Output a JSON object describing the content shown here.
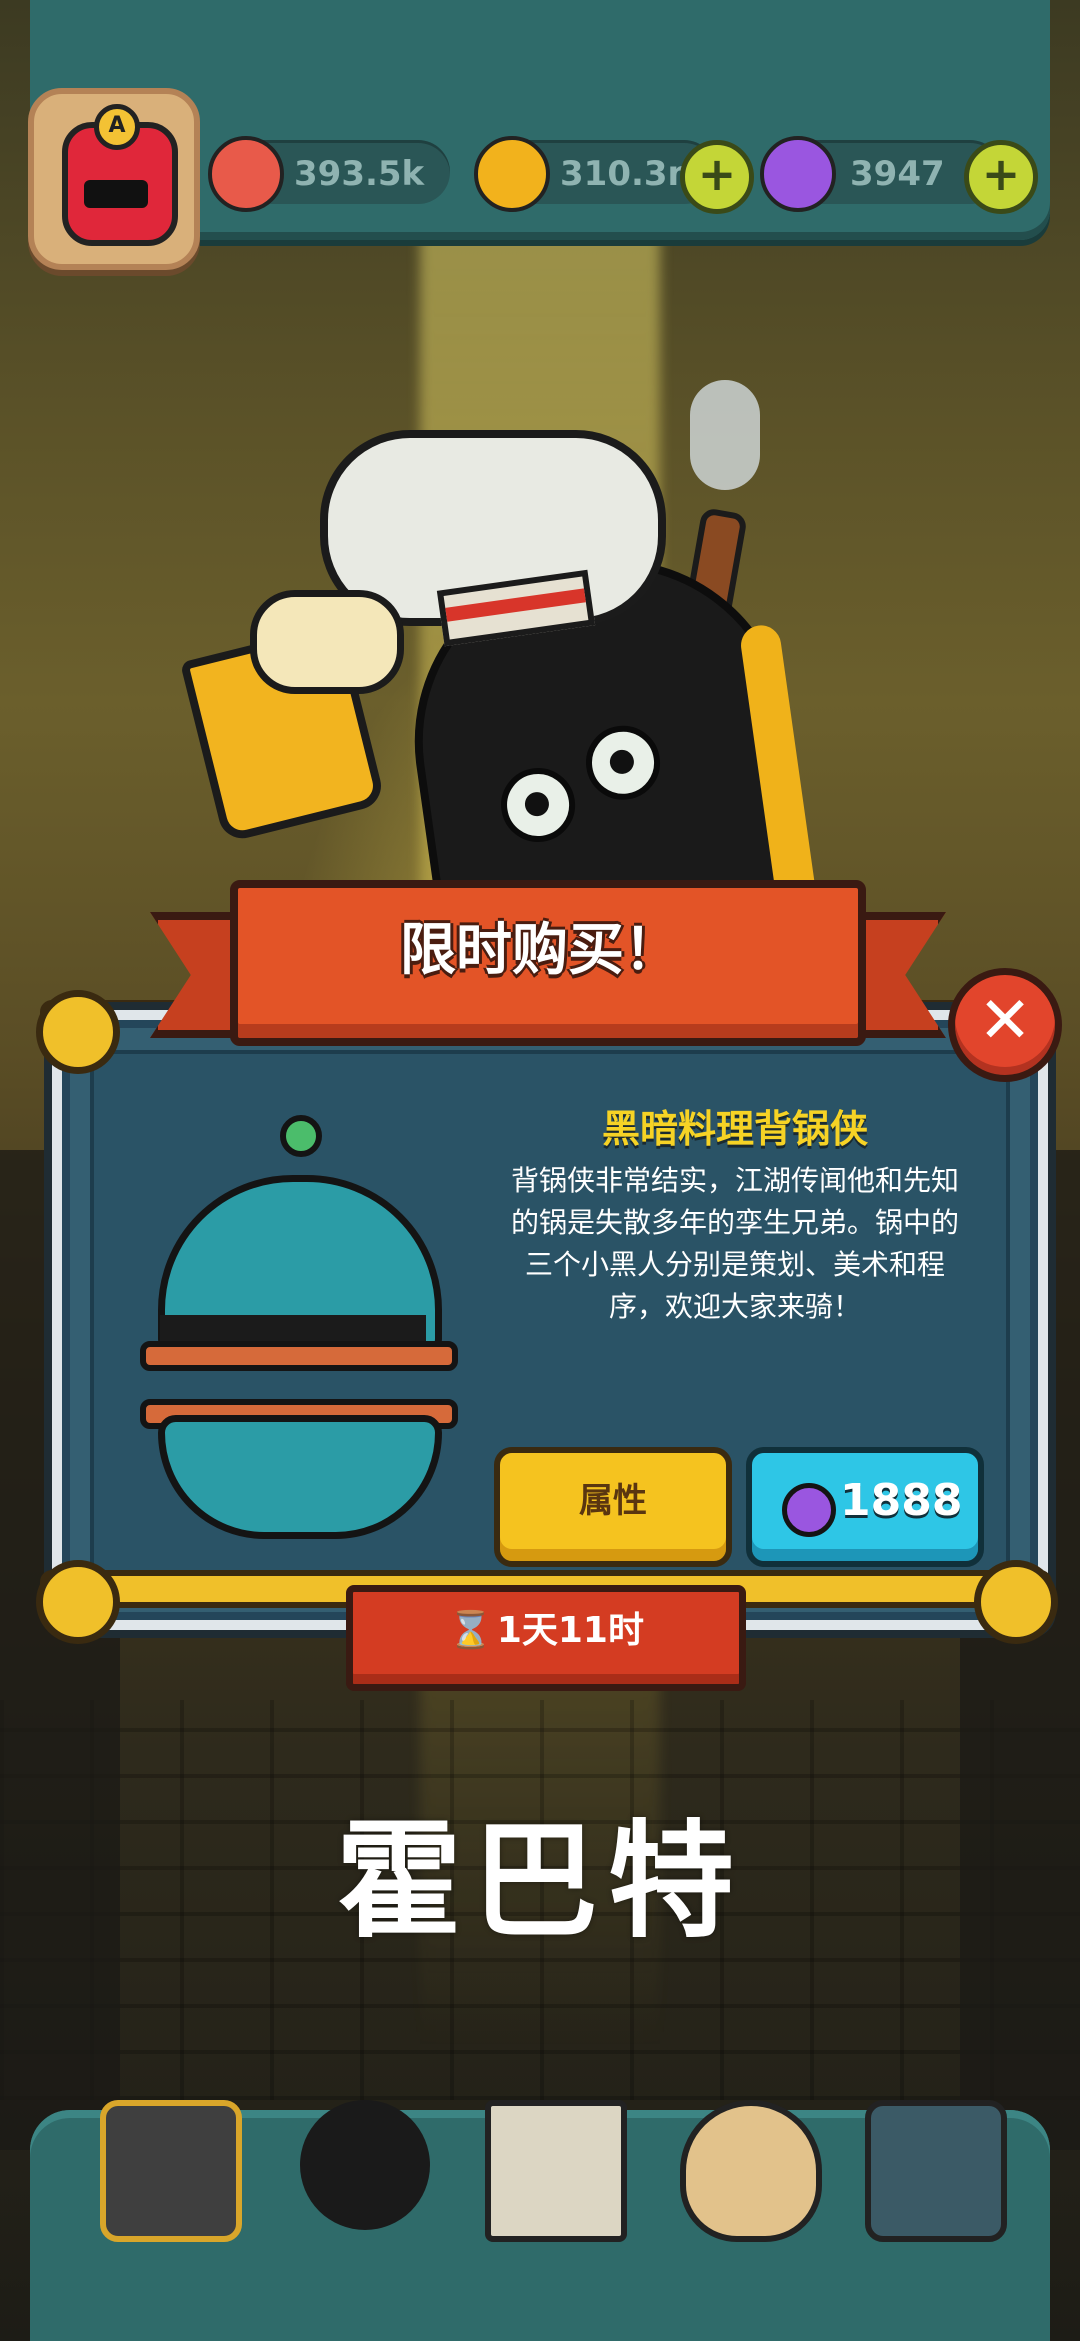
{
  "hud": {
    "resources": [
      {
        "icon": "eyeball-icon",
        "value": "393.5k"
      },
      {
        "icon": "gold-coin-icon",
        "value": "310.3m"
      },
      {
        "icon": "potion-icon",
        "value": "3947"
      }
    ],
    "avatar_badge": "A"
  },
  "offer": {
    "banner": "限时购买！",
    "title": "黑暗料理背锅侠",
    "description": "背锅侠非常结实，江湖传闻他和先知的锅是失散多年的孪生兄弟。锅中的三个小黑人分别是策划、美术和程序，欢迎大家来骑！",
    "attributes_button": "属性",
    "price": "1888",
    "timer": "1天11时",
    "close_symbol": "✕"
  },
  "overlay": {
    "watermark": "霍巴特"
  },
  "colors": {
    "hud_teal": "#2f6b6a",
    "banner_red": "#e35427",
    "panel_blue": "#345f72",
    "title_yellow": "#f6d325",
    "buy_cyan": "#2ec6e6",
    "attr_yellow": "#f5c31f"
  },
  "nav": [
    {
      "icon": "shop-building-icon"
    },
    {
      "icon": "monster-icon"
    },
    {
      "icon": "book-icon"
    },
    {
      "icon": "coin-bag-icon"
    },
    {
      "icon": "grid-icon"
    }
  ]
}
